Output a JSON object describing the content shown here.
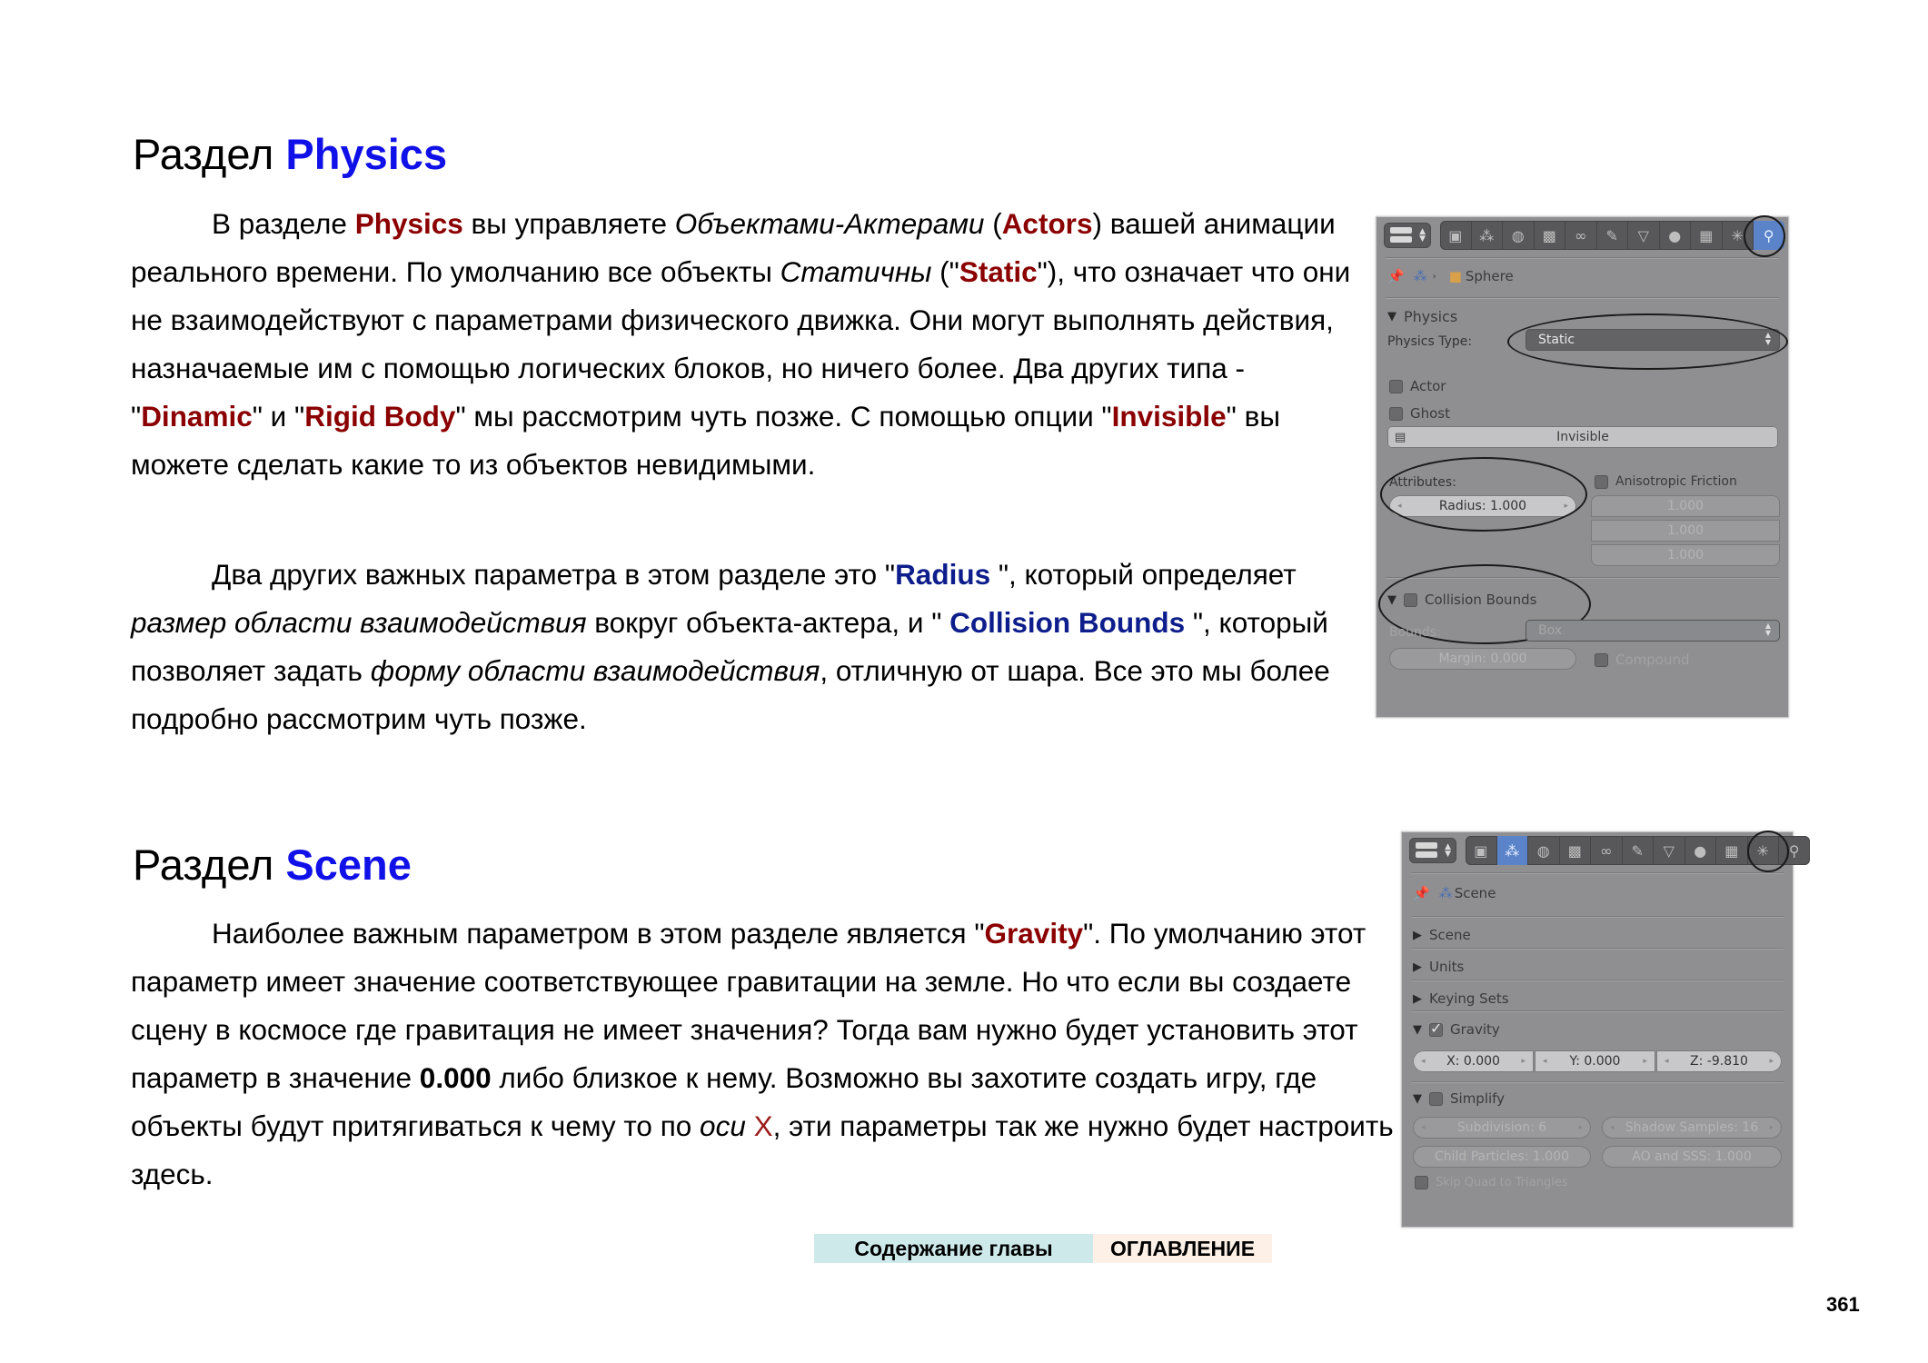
{
  "physics_section": {
    "title_prefix": "Раздел",
    "title_accent": "Physics",
    "p1": {
      "t1": "В разделе ",
      "k1": "Physics",
      "t2": " вы управляете ",
      "i1": "Объектами-Актерами",
      "t3": " (",
      "k2": "Actors",
      "t4": ") вашей анимации реального времени. По умолчанию все объекты ",
      "i2": "Статичны",
      "t5": " (\"",
      "k3": "Static",
      "t6": "\"), что означает что они не взаимодействуют с параметрами физического движка. Они могут выполнять действия, назначаемые им с помощью логических блоков, но ничего более. Два других типа - \"",
      "k4": "Dinamic",
      "t7": "\" и \"",
      "k5": "Rigid Body",
      "t8": "\" мы рассмотрим чуть позже. С помощью опции \"",
      "k6": "Invisible",
      "t9": "\" вы можете сделать какие то из объектов невидимыми."
    },
    "p2": {
      "t1": "Два других важных параметра в этом разделе это \"",
      "k1": "Radius",
      "t2": " \", который определяет ",
      "i1": "размер области взаимодействия",
      "t3": " вокруг объекта-актера, и \" ",
      "k2": "Collision Bounds",
      "t4": " \", который позволяет задать ",
      "i2": "форму области взаимодействия",
      "t5": ", отличную от шара. Все это мы более подробно рассмотрим чуть позже."
    }
  },
  "scene_section": {
    "title_prefix": "Раздел",
    "title_accent": "Scene",
    "p1": {
      "t1": "Наиболее важным параметром в этом разделе является \"",
      "k1": "Gravity",
      "t2": "\". По умолчанию этот параметр имеет значение соответствующее гравитации на земле. Но что если вы создаете сцену в космосе где гравитация не имеет значения? Тогда вам нужно будет установить этот параметр в значение ",
      "b1": "0.000",
      "t3": " либо близкое к нему. Возможно вы захотите создать игру, где объекты будут притягиваться к чему то по ",
      "i1": "оси",
      "t4": " ",
      "x1": "X",
      "t5": ", эти параметры так же нужно будет настроить здесь."
    }
  },
  "physics_panel": {
    "tabs": [
      "render-icon",
      "scene-icon",
      "world-icon",
      "object-icon",
      "constraints-icon",
      "modifiers-icon",
      "data-icon",
      "material-icon",
      "texture-icon",
      "particles-icon",
      "physics-icon"
    ],
    "tab_glyphs": [
      "▣",
      "⁂",
      "◍",
      "▩",
      "∞",
      "✎",
      "▽",
      "●",
      "▦",
      "✳",
      "⚲"
    ],
    "active_tab": 10,
    "breadcrumb_object": "Sphere",
    "section_label": "Physics",
    "physics_type_label": "Physics Type:",
    "physics_type_value": "Static",
    "actor_label": "Actor",
    "ghost_label": "Ghost",
    "invisible_label": "Invisible",
    "attributes_label": "Attributes:",
    "radius_field": "Radius: 1.000",
    "aniso_label": "Anisotropic Friction",
    "aniso_values": [
      "1.000",
      "1.000",
      "1.000"
    ],
    "collision_bounds_label": "Collision Bounds",
    "bounds_label": "Bounds:",
    "bounds_value": "Box",
    "margin_field": "Margin: 0.000",
    "compound_label": "Compound"
  },
  "scene_panel": {
    "tab_glyphs": [
      "▣",
      "⁂",
      "◍",
      "▩",
      "∞",
      "✎",
      "▽",
      "●",
      "▦",
      "✳",
      "⚲"
    ],
    "active_tab": 1,
    "breadcrumb_scene": "Scene",
    "sections": [
      "Scene",
      "Units",
      "Keying Sets"
    ],
    "gravity_label": "Gravity",
    "gravity_checked": true,
    "gravity_x": "X: 0.000",
    "gravity_y": "Y: 0.000",
    "gravity_z": "Z: -9.810",
    "simplify_label": "Simplify",
    "subdivision": "Subdivision: 6",
    "shadow_samples": "Shadow Samples: 16",
    "child_particles": "Child Particles: 1.000",
    "ao_sss": "AO and SSS: 1.000",
    "skip_quad": "Skip Quad to Triangles"
  },
  "nav": {
    "chapter_contents": "Содержание главы",
    "toc": "ОГЛАВЛЕНИЕ",
    "chapter_color": "#cde9ea",
    "toc_color": "#fdf0e6"
  },
  "page_number": "361"
}
